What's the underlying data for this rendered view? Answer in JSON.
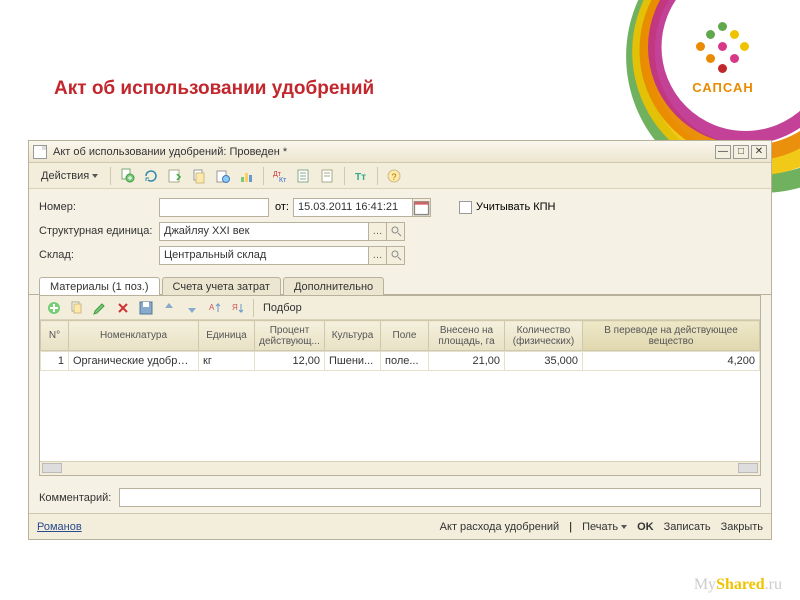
{
  "branding": {
    "logo_text": "САПСАН"
  },
  "page": {
    "title": "Акт об использовании удобрений"
  },
  "window": {
    "title": "Акт об использовании удобрений: Проведен *",
    "menu": {
      "actions": "Действия"
    }
  },
  "form": {
    "number_label": "Номер:",
    "number_value": "",
    "from_label": "от:",
    "date_value": "15.03.2011 16:41:21",
    "kpn_checkbox_label": "Учитывать КПН",
    "org_label": "Структурная единица:",
    "org_value": "Джайляу XXI век",
    "warehouse_label": "Склад:",
    "warehouse_value": "Центральный склад"
  },
  "tabs": {
    "materials": "Материалы (1 поз.)",
    "accounts": "Счета учета затрат",
    "additional": "Дополнительно"
  },
  "grid_toolbar": {
    "select": "Подбор"
  },
  "grid": {
    "columns": {
      "n": "N°",
      "nomen": "Номенклатура",
      "unit": "Единица",
      "percent": "Процент действующ...",
      "culture": "Культура",
      "field": "Поле",
      "applied": "Внесено на площадь, га",
      "qty": "Количество (физических)",
      "active": "В переводе на действующее вещество"
    },
    "rows": [
      {
        "n": "1",
        "nomen": "Органические удобрения",
        "unit": "кг",
        "percent": "12,00",
        "culture": "Пшени...",
        "field": "поле...",
        "applied": "21,00",
        "qty": "35,000",
        "active": "4,200"
      }
    ]
  },
  "comment": {
    "label": "Комментарий:",
    "value": ""
  },
  "footer": {
    "user": "Романов",
    "expense_act": "Акт расхода удобрений",
    "print": "Печать",
    "ok": "OK",
    "save": "Записать",
    "close": "Закрыть"
  },
  "watermark": {
    "a": "My",
    "b": "Shared",
    "c": ".ru"
  }
}
